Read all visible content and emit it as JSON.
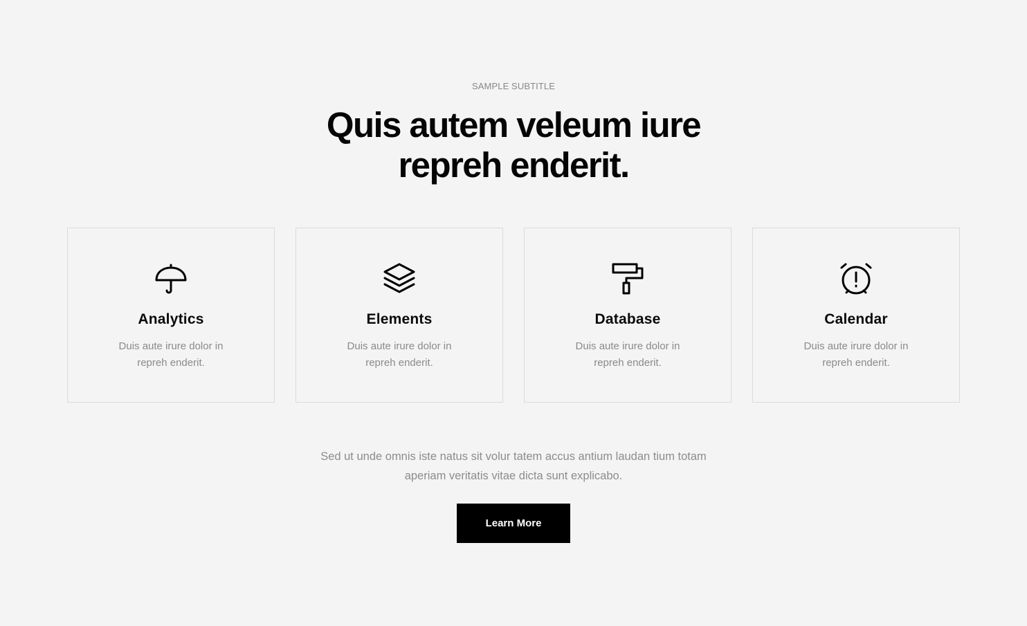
{
  "section": {
    "subtitle": "SAMPLE SUBTITLE",
    "heading": "Quis autem veleum iure repreh enderit.",
    "intro": "Sed ut unde omnis iste natus sit volur tatem accus antium laudan tium totam aperiam veritatis vitae dicta sunt explicabo.",
    "button_label": "Learn More"
  },
  "cards": [
    {
      "icon": "umbrella-icon",
      "title": "Analytics",
      "text": "Duis aute irure dolor in repreh enderit."
    },
    {
      "icon": "layers-icon",
      "title": "Elements",
      "text": "Duis aute irure dolor in repreh enderit."
    },
    {
      "icon": "paint-roller-icon",
      "title": "Database",
      "text": "Duis aute irure dolor in repreh enderit."
    },
    {
      "icon": "alarm-clock-icon",
      "title": "Calendar",
      "text": "Duis aute irure dolor in repreh enderit."
    }
  ],
  "colors": {
    "background": "#f4f4f4",
    "heading": "#050505",
    "muted_text": "#8a8a8a",
    "card_border": "#dadada",
    "button_bg": "#000000",
    "button_text": "#ffffff"
  }
}
